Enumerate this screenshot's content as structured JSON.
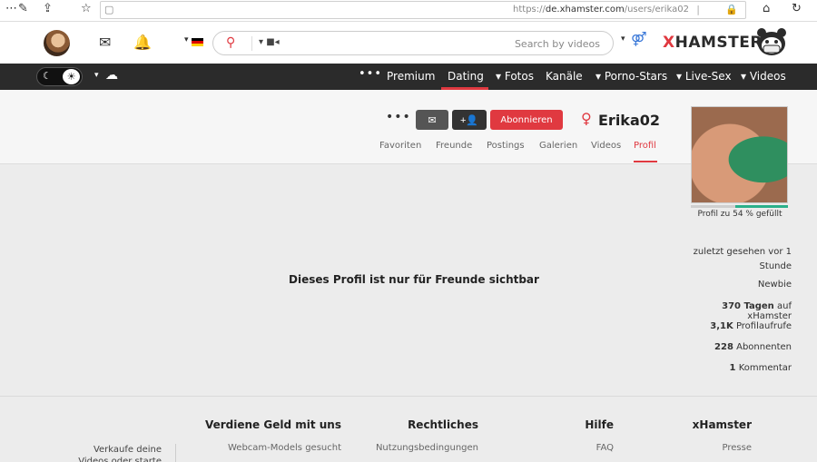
{
  "browser": {
    "url_proto": "https://",
    "url_host": "de.xhamster.com",
    "url_path": "/users/erika02"
  },
  "header": {
    "logo_x": "X",
    "logo_rest": "HAMSTER",
    "search_placeholder": "Search by videos",
    "search_category_icon": "video-camera-icon"
  },
  "nav": {
    "items": [
      "Videos",
      "Live-Sex",
      "Porno-Stars",
      "Kanäle",
      "Fotos",
      "Dating",
      "Premium"
    ],
    "active": "Dating"
  },
  "profile": {
    "name": "Erika02",
    "subscribe_label": "Abonnieren",
    "tabs": [
      "Profil",
      "Videos",
      "Galerien",
      "Postings",
      "Freunde",
      "Favoriten"
    ],
    "active_tab": "Profil",
    "completion_percent": 54,
    "completion_label": "Profil zu 54 % gefüllt",
    "private_message": "Dieses Profil ist nur für Freunde sichtbar"
  },
  "stats": {
    "last_seen_1": "zuletzt gesehen vor 1",
    "last_seen_2": "Stunde",
    "level": "Newbie",
    "days_value": "370 Tagen",
    "days_rest": "auf xHamster",
    "views_value": "3,1K",
    "views_rest": "Profilaufrufe",
    "subs_value": "228",
    "subs_rest": "Abonnenten",
    "comments_value": "1",
    "comments_rest": "Kommentar"
  },
  "footer": {
    "col1_title": "xHamster",
    "col1_link": "Presse",
    "col2_title": "Hilfe",
    "col2_link": "FAQ",
    "col3_title": "Rechtliches",
    "col3_link": "Nutzungsbedingungen",
    "col4_title": "Verdiene Geld mit uns",
    "col4_link": "Webcam-Models gesucht",
    "note": "Verkaufe deine Videos oder starte eine Cam-"
  },
  "colors": {
    "brand_red": "#e03940",
    "nav_bg": "#2b2b2b",
    "progress_green": "#2bb08a"
  }
}
